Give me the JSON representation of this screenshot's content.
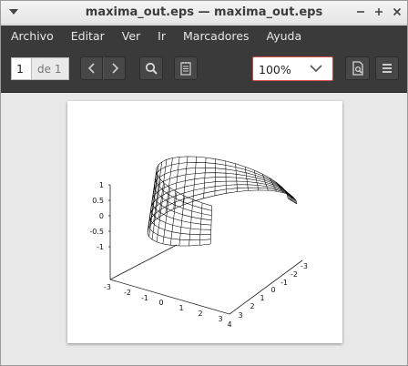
{
  "window": {
    "title": "maxima_out.eps — maxima_out.eps"
  },
  "menu": [
    "Archivo",
    "Editar",
    "Ver",
    "Ir",
    "Marcadores",
    "Ayuda"
  ],
  "toolbar": {
    "page_current": "1",
    "page_total": "de 1",
    "zoom": "100%"
  },
  "plot": {
    "z_ticks": [
      "1",
      "0.5",
      "0",
      "-0.5",
      "-1"
    ],
    "x_ticks": [
      "-3",
      "-2",
      "-1",
      "0",
      "1",
      "2",
      "3"
    ],
    "y_ticks": [
      "4",
      "3",
      "2",
      "1",
      "0",
      "-1",
      "-2",
      "-3"
    ]
  }
}
